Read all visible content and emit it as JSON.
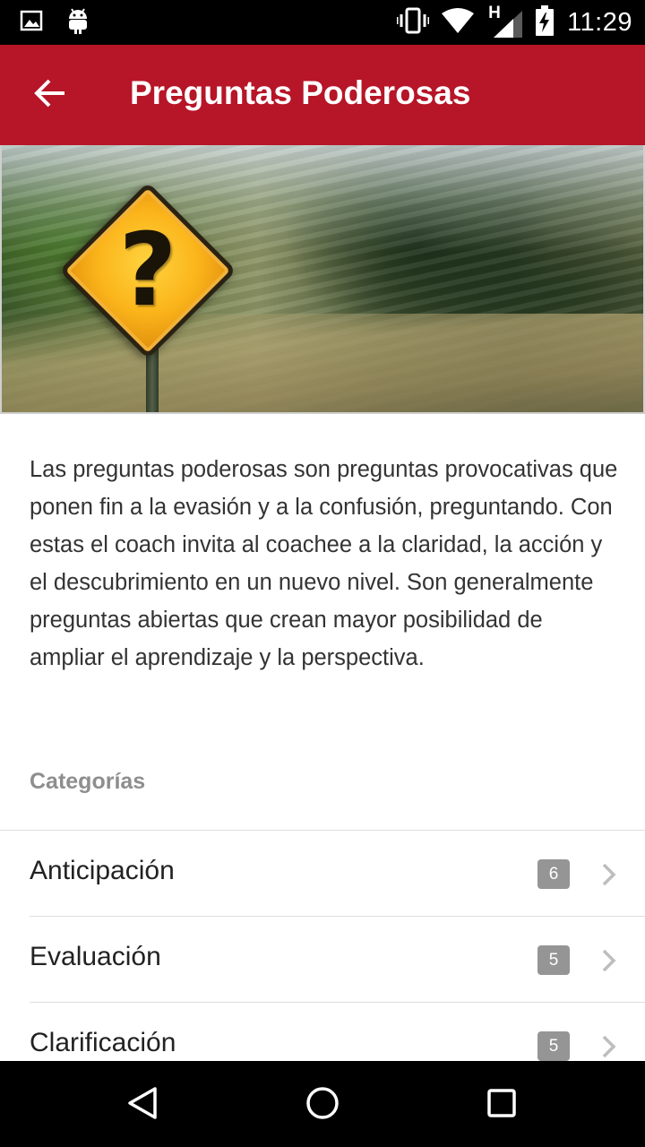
{
  "status_bar": {
    "time": "11:29",
    "network_label": "H",
    "icons": [
      "image-icon",
      "android-icon",
      "vibrate-icon",
      "wifi-icon",
      "signal-icon",
      "battery-charging-icon"
    ]
  },
  "app_bar": {
    "title": "Preguntas Poderosas",
    "back_icon": "arrow-back-icon",
    "color": "#b71528"
  },
  "hero": {
    "image": "question-mark-road-sign"
  },
  "description": "Las preguntas poderosas son preguntas provocativas que ponen fin a la evasión y a la confusión, preguntando. Con estas el coach invita al coachee a la claridad, la acción y el descubrimiento en un nuevo nivel. Son generalmente preguntas abiertas que crean mayor posibilidad de ampliar el aprendizaje y la perspectiva.",
  "categories": {
    "header": "Categorías",
    "items": [
      {
        "label": "Anticipación",
        "count": "6"
      },
      {
        "label": "Evaluación",
        "count": "5"
      },
      {
        "label": "Clarificación",
        "count": "5"
      }
    ]
  },
  "nav_bar": {
    "buttons": [
      "back-triangle-icon",
      "home-circle-icon",
      "recents-square-icon"
    ]
  }
}
